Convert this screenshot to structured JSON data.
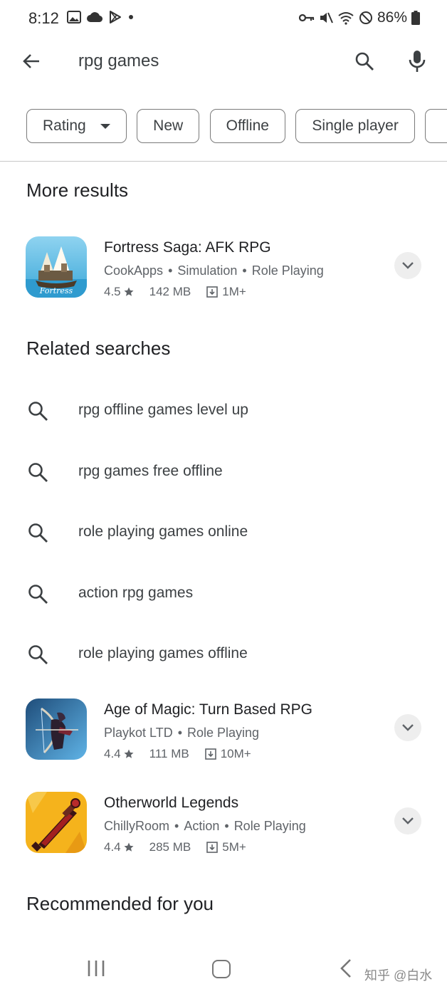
{
  "status_bar": {
    "time": "8:12",
    "battery_pct": "86%",
    "icons_left": [
      "gallery-icon",
      "cloud-icon",
      "play-store-icon",
      "dot-icon"
    ],
    "icons_right": [
      "key-icon",
      "mute-icon",
      "wifi-icon",
      "do-not-disturb-icon",
      "battery-icon"
    ]
  },
  "search": {
    "query": "rpg games"
  },
  "chips": [
    {
      "label": "Rating",
      "dropdown": true
    },
    {
      "label": "New"
    },
    {
      "label": "Offline"
    },
    {
      "label": "Single player"
    }
  ],
  "sections": {
    "more_results": "More results",
    "related_searches": "Related searches",
    "recommended": "Recommended for you"
  },
  "apps": [
    {
      "title": "Fortress Saga: AFK RPG",
      "developer": "CookApps",
      "categories": [
        "Simulation",
        "Role Playing"
      ],
      "rating": "4.5",
      "size": "142 MB",
      "downloads": "1M+"
    },
    {
      "title": "Age of Magic: Turn Based RPG",
      "developer": "Playkot LTD",
      "categories": [
        "Role Playing"
      ],
      "rating": "4.4",
      "size": "111 MB",
      "downloads": "10M+"
    },
    {
      "title": "Otherworld Legends",
      "developer": "ChillyRoom",
      "categories": [
        "Action",
        "Role Playing"
      ],
      "rating": "4.4",
      "size": "285 MB",
      "downloads": "5M+"
    }
  ],
  "related": [
    "rpg offline games level up",
    "rpg games free offline",
    "role playing games online",
    "action rpg games",
    "role playing games offline"
  ],
  "watermark": "知乎 @白水",
  "colors": {
    "text_primary": "#202124",
    "text_secondary": "#5f6368",
    "chip_border": "#7a7a7a"
  }
}
